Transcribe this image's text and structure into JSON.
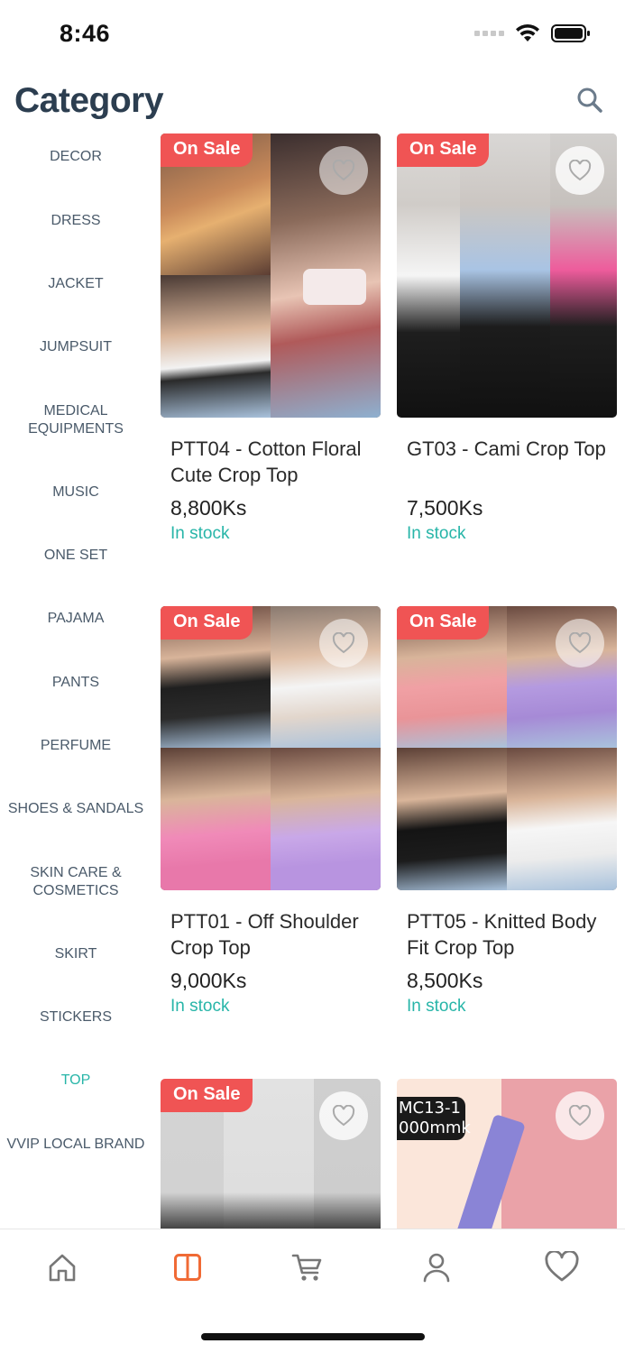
{
  "status_bar": {
    "time": "8:46"
  },
  "header": {
    "title": "Category"
  },
  "colors": {
    "accent": "#27b5a8",
    "sale": "#f05454",
    "active_tab": "#f06a35"
  },
  "categories": [
    {
      "label": "DECOR",
      "active": false
    },
    {
      "label": "DRESS",
      "active": false
    },
    {
      "label": "JACKET",
      "active": false
    },
    {
      "label": "JUMPSUIT",
      "active": false
    },
    {
      "label": "MEDICAL EQUIPMENTS",
      "line1": "MEDICAL",
      "line2": "EQUIPMENTS",
      "active": false
    },
    {
      "label": "MUSIC",
      "active": false
    },
    {
      "label": "ONE SET",
      "active": false
    },
    {
      "label": "PAJAMA",
      "active": false
    },
    {
      "label": "PANTS",
      "active": false
    },
    {
      "label": "PERFUME",
      "active": false
    },
    {
      "label": "SHOES & SANDALS",
      "active": false
    },
    {
      "label": "SKIN CARE & COSMETICS",
      "line1": "SKIN CARE &",
      "line2": "COSMETICS",
      "active": false
    },
    {
      "label": "SKIRT",
      "active": false
    },
    {
      "label": "STICKERS",
      "active": false
    },
    {
      "label": "TOP",
      "active": true
    },
    {
      "label": "VVIP LOCAL BRAND",
      "active": false
    }
  ],
  "products": [
    {
      "badge": "On Sale",
      "name": "PTT04 - Cotton Floral Cute Crop Top",
      "price": "8,800Ks",
      "stock": "In stock"
    },
    {
      "badge": "On Sale",
      "name": "GT03 - Cami Crop Top",
      "price": "7,500Ks",
      "stock": "In stock"
    },
    {
      "badge": "On Sale",
      "name": "PTT01 - Off Shoulder Crop Top",
      "price": "9,000Ks",
      "stock": "In stock"
    },
    {
      "badge": "On Sale",
      "name": "PTT05 - Knitted Body Fit Crop Top",
      "price": "8,500Ks",
      "stock": "In stock"
    },
    {
      "badge": "On Sale",
      "name": "",
      "price": "",
      "stock": ""
    },
    {
      "badge": "",
      "name": "",
      "price": "",
      "stock": "",
      "image_text": "MC13-1 000mmk"
    }
  ],
  "tab_bar": {
    "tabs": [
      {
        "icon": "home-icon"
      },
      {
        "icon": "category-icon",
        "active": true
      },
      {
        "icon": "cart-icon"
      },
      {
        "icon": "profile-icon"
      },
      {
        "icon": "heart-icon"
      }
    ]
  }
}
